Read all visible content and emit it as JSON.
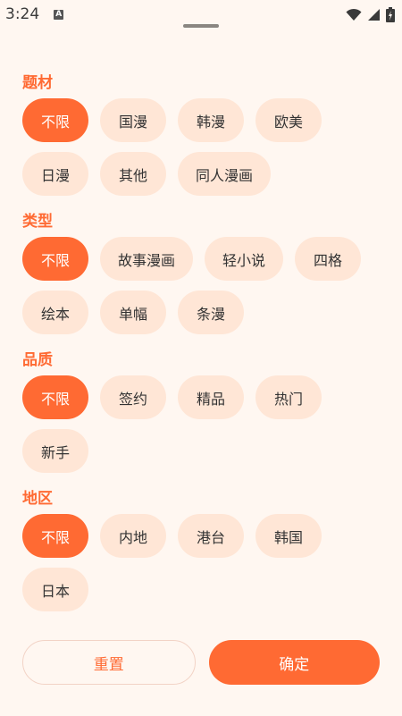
{
  "status_bar": {
    "time": "3:24",
    "a_icon": "A"
  },
  "colors": {
    "accent": "#ff6a33",
    "chip_bg": "#ffe6d6",
    "page_bg": "#fff7f1"
  },
  "sections": [
    {
      "title": "题材",
      "options": [
        {
          "label": "不限",
          "selected": true
        },
        {
          "label": "国漫",
          "selected": false
        },
        {
          "label": "韩漫",
          "selected": false
        },
        {
          "label": "欧美",
          "selected": false
        },
        {
          "label": "日漫",
          "selected": false
        },
        {
          "label": "其他",
          "selected": false
        },
        {
          "label": "同人漫画",
          "selected": false
        }
      ]
    },
    {
      "title": "类型",
      "options": [
        {
          "label": "不限",
          "selected": true
        },
        {
          "label": "故事漫画",
          "selected": false
        },
        {
          "label": "轻小说",
          "selected": false
        },
        {
          "label": "四格",
          "selected": false
        },
        {
          "label": "绘本",
          "selected": false
        },
        {
          "label": "单幅",
          "selected": false
        },
        {
          "label": "条漫",
          "selected": false
        }
      ]
    },
    {
      "title": "品质",
      "options": [
        {
          "label": "不限",
          "selected": true
        },
        {
          "label": "签约",
          "selected": false
        },
        {
          "label": "精品",
          "selected": false
        },
        {
          "label": "热门",
          "selected": false
        },
        {
          "label": "新手",
          "selected": false
        }
      ]
    },
    {
      "title": "地区",
      "options": [
        {
          "label": "不限",
          "selected": true
        },
        {
          "label": "内地",
          "selected": false
        },
        {
          "label": "港台",
          "selected": false
        },
        {
          "label": "韩国",
          "selected": false
        },
        {
          "label": "日本",
          "selected": false
        }
      ]
    }
  ],
  "buttons": {
    "reset": "重置",
    "confirm": "确定"
  }
}
